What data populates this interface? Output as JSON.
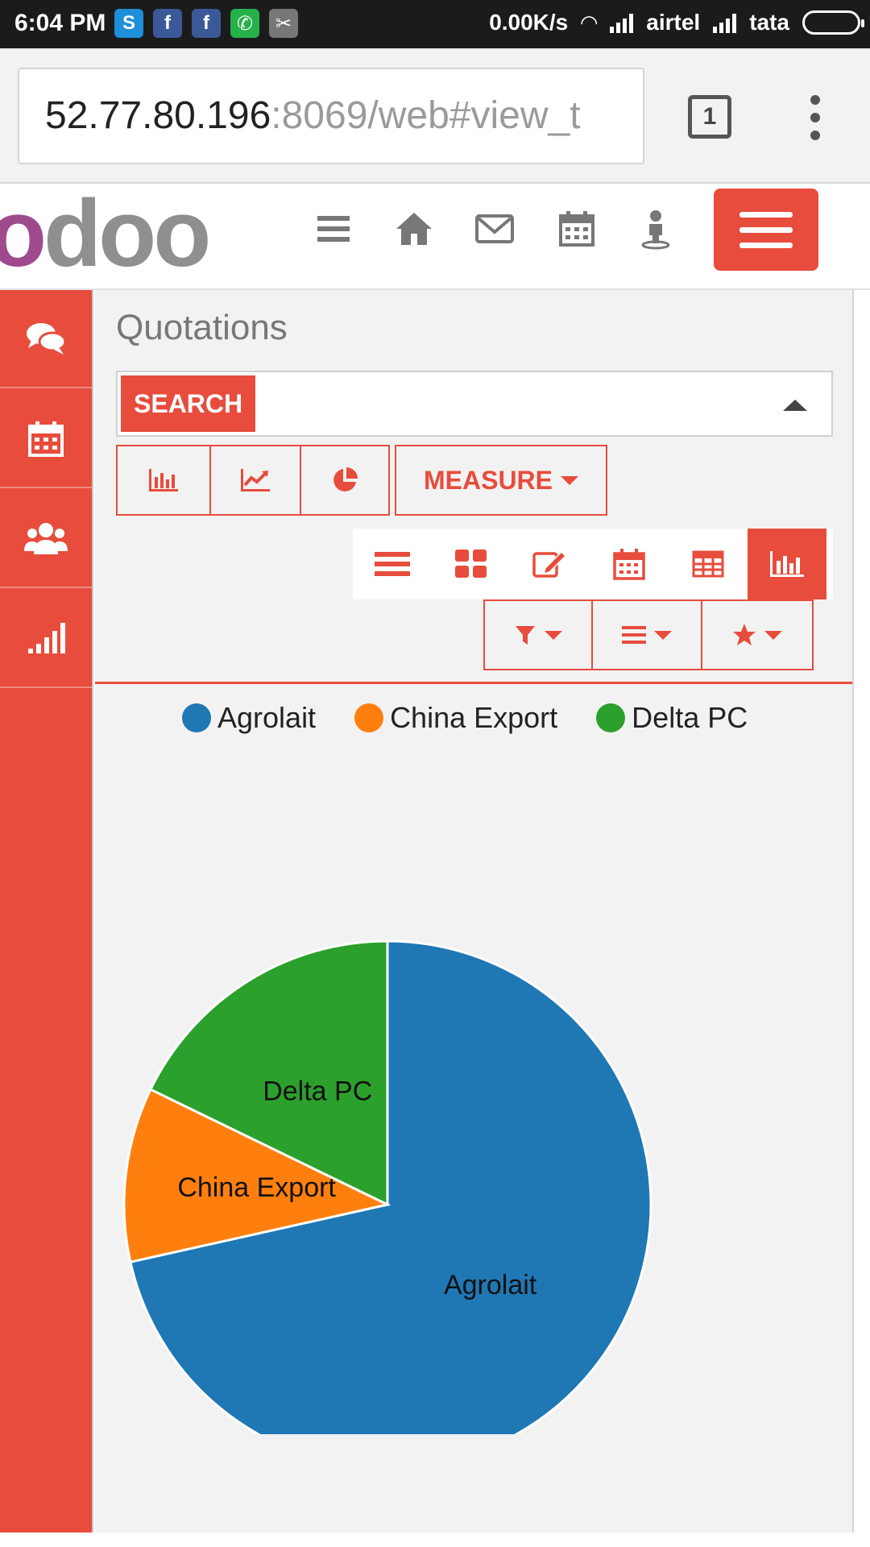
{
  "status_bar": {
    "time": "6:04 PM",
    "speed": "0.00K/s",
    "carrier1": "airtel",
    "carrier2": "tata",
    "apps": [
      "skype-icon",
      "facebook-icon",
      "facebook-icon",
      "whatsapp-icon",
      "clipboard-icon"
    ]
  },
  "browser": {
    "url_host": "52.77.80.196",
    "url_rest": ":8069/web#view_t",
    "tab_count": "1"
  },
  "header": {
    "logo": "odoo",
    "icons": [
      "menu-lines-icon",
      "home-icon",
      "envelope-icon",
      "calendar-icon",
      "user-icon"
    ],
    "accent": "#e74c3c"
  },
  "sidebar": {
    "items": [
      "comments-icon",
      "calendar-icon",
      "users-icon",
      "signal-bars-icon"
    ]
  },
  "main": {
    "title": "Quotations",
    "search_label": "SEARCH",
    "chart_types": [
      "bar-chart-icon",
      "line-chart-icon",
      "pie-chart-icon"
    ],
    "measure_label": "MEASURE",
    "views": [
      "list-view-icon",
      "kanban-view-icon",
      "form-view-icon",
      "calendar-view-icon",
      "pivot-view-icon",
      "graph-view-icon"
    ],
    "active_view": "graph-view-icon",
    "filters": [
      "filter-icon",
      "group-by-icon",
      "favorites-icon"
    ]
  },
  "chart_data": {
    "type": "pie",
    "title": "",
    "categories": [
      "Agrolait",
      "China Export",
      "Delta PC"
    ],
    "values": [
      71.5,
      10.7,
      17.8
    ],
    "colors": [
      "#1f77b4",
      "#ff7f0e",
      "#2ca02c"
    ],
    "legend": "top"
  }
}
